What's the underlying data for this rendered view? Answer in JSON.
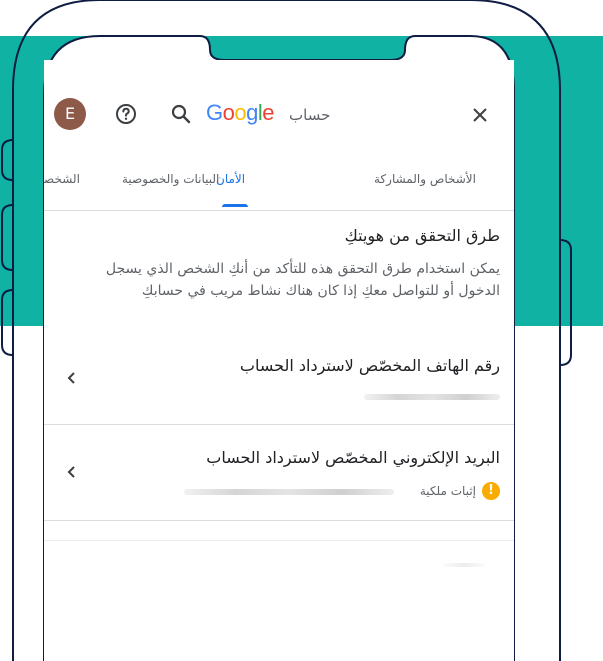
{
  "colors": {
    "teal": "#10b3a3",
    "outline": "#0f1d44",
    "accent_blue": "#1a73e8",
    "warning": "#f9ab00"
  },
  "topbar": {
    "avatar_letter": "E",
    "help_icon": "help-circle-icon",
    "search_icon": "search-icon",
    "logo_text": "Google",
    "account_word": "حساب",
    "close_icon": "close-icon"
  },
  "tabs": [
    {
      "label": "الشخصية"
    },
    {
      "label": "البيانات والخصوصية"
    },
    {
      "label": "الأمان",
      "active": true
    },
    {
      "label": "الأشخاص والمشاركة"
    }
  ],
  "section": {
    "title": "طرق التحقق من هويتكِ",
    "description": "يمكن استخدام طرق التحقق هذه للتأكد من أنكِ الشخص الذي يسجل الدخول أو للتواصل معكِ إذا كان هناك نشاط مريب في حسابكِ"
  },
  "recovery_phone": {
    "title": "رقم الهاتف المخصّص لاسترداد الحساب"
  },
  "recovery_email": {
    "title": "البريد الإلكتروني المخصّص لاسترداد الحساب",
    "status_label": "إثبات ملكية",
    "status_icon": "warning-icon"
  }
}
